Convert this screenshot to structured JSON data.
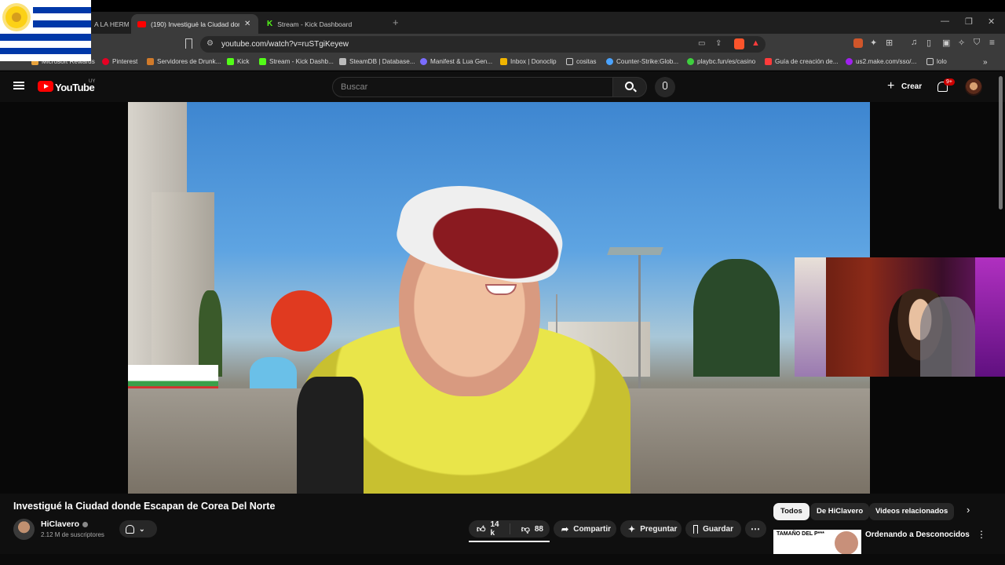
{
  "browser": {
    "tabs": [
      {
        "label": "A LA HERM",
        "active": false
      },
      {
        "label": "(190) Investigué la Ciudad donde",
        "active": true
      },
      {
        "label": "Stream - Kick Dashboard",
        "active": false
      }
    ],
    "url": "youtube.com/watch?v=ruSTgiKeyew",
    "bookmarks": [
      {
        "label": "Microsoft Rewards",
        "color": "#e8a33d"
      },
      {
        "label": "Pinterest",
        "color": "#e60023"
      },
      {
        "label": "Servidores de Drunk...",
        "color": "#d07a2a"
      },
      {
        "label": "Kick",
        "color": "#53fc18"
      },
      {
        "label": "Stream - Kick Dashb...",
        "color": "#53fc18"
      },
      {
        "label": "SteamDB | Database...",
        "color": "#bbbbbb"
      },
      {
        "label": "Manifest & Lua Gen...",
        "color": "#7a6cff"
      },
      {
        "label": "Inbox | Donoclip",
        "color": "#f0b400"
      },
      {
        "label": "cositas",
        "color": "folder"
      },
      {
        "label": "Counter-Strike:Glob...",
        "color": "#4aa3ff"
      },
      {
        "label": "playbc.fun/es/casino",
        "color": "#3ecf3e"
      },
      {
        "label": "Guía de creación de...",
        "color": "#ff3b3b"
      },
      {
        "label": "us2.make.com/sso/...",
        "color": "#a020f0"
      },
      {
        "label": "lolo",
        "color": "folder"
      }
    ]
  },
  "youtube": {
    "logo_text": "YouTube",
    "region": "UY",
    "search_placeholder": "Buscar",
    "create_label": "Crear",
    "notif_badge": "9+",
    "video_title": "Investigué la Ciudad donde Escapan de Corea Del Norte",
    "channel_name": "HiClavero",
    "subscribers": "2.12 M de suscriptores",
    "likes": "14 k",
    "dislikes": "88",
    "share_label": "Compartir",
    "ask_label": "Preguntar",
    "save_label": "Guardar",
    "chips": [
      "Todos",
      "De HiClavero",
      "Videos relacionados"
    ],
    "related_title": "Ordenando a Desconocidos",
    "related_thumb_text": "TAMAÑO DEL P***"
  },
  "colors": {
    "yt_red": "#ff0000",
    "bg": "#0f0f0f",
    "flag_blue": "#0038a8",
    "sun": "#fcd116"
  }
}
